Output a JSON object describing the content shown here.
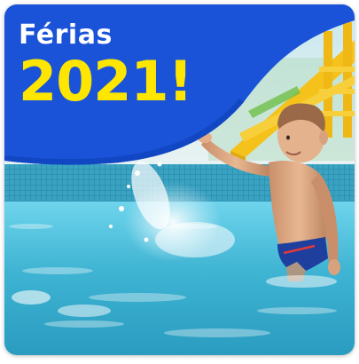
{
  "banner": {
    "title": "Férias",
    "year": "2021!",
    "colors": {
      "banner_blue": "#1a53d8",
      "title_white": "#ffffff",
      "year_yellow": "#ffe600",
      "water": "#39b8d6",
      "pool_tile": "#2a8fb0",
      "slide_yellow": "#f5c21b"
    },
    "photo": {
      "subject": "child-splashing-in-pool",
      "icon": "photo-icon"
    }
  }
}
